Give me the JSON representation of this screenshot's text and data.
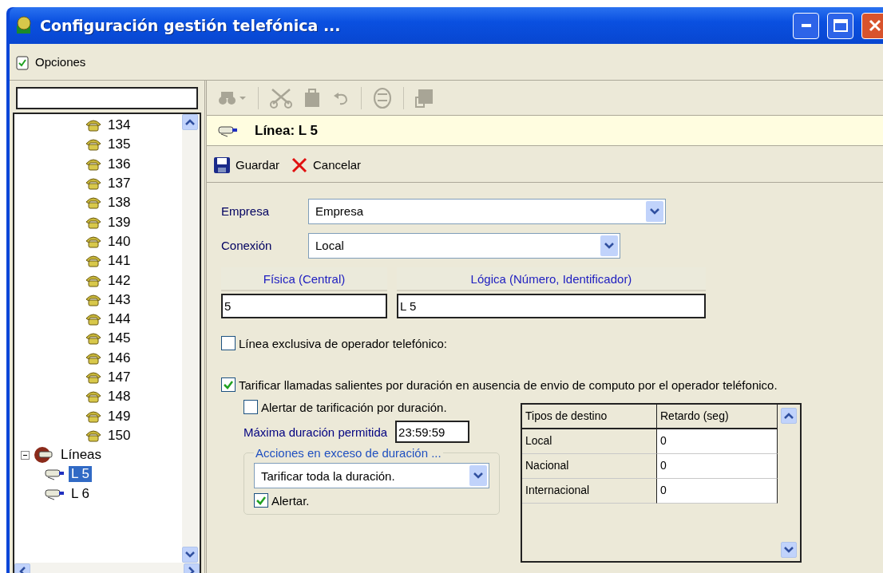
{
  "window": {
    "title": "Configuración gestión telefónica ..."
  },
  "menu": [
    {
      "label": "Opciones"
    }
  ],
  "tree": {
    "continued_branch": [
      {
        "label": "134",
        "selected": false
      },
      {
        "label": "135",
        "selected": false
      },
      {
        "label": "136",
        "selected": false
      },
      {
        "label": "137",
        "selected": false
      },
      {
        "label": "138",
        "selected": false
      },
      {
        "label": "139",
        "selected": false
      },
      {
        "label": "140",
        "selected": false
      },
      {
        "label": "141",
        "selected": false
      },
      {
        "label": "142",
        "selected": false
      },
      {
        "label": "143",
        "selected": false
      },
      {
        "label": "144",
        "selected": false
      },
      {
        "label": "145",
        "selected": false
      },
      {
        "label": "146",
        "selected": false
      },
      {
        "label": "147",
        "selected": false
      },
      {
        "label": "148",
        "selected": false
      },
      {
        "label": "149",
        "selected": false
      },
      {
        "label": "150",
        "selected": false
      }
    ],
    "items": [
      {
        "label": "Líneas",
        "expanded": true,
        "selected": false,
        "children": [
          {
            "label": "L 5",
            "selected": true
          },
          {
            "label": "L 6",
            "selected": false
          }
        ]
      }
    ]
  },
  "toolbar": [
    {
      "kind": "find",
      "disabled": true
    },
    {
      "kind": "cut",
      "disabled": true
    },
    {
      "kind": "paste",
      "disabled": true
    },
    {
      "kind": "undo",
      "disabled": true
    },
    {
      "kind": "face",
      "disabled": true
    },
    {
      "kind": "export",
      "disabled": true
    }
  ],
  "header": {
    "title": "Línea: L 5"
  },
  "actions": [
    {
      "kind": "save",
      "label": "Guardar"
    },
    {
      "kind": "cancel",
      "label": "Cancelar"
    }
  ],
  "form": {
    "empresa": {
      "label": "Empresa",
      "value": "Empresa"
    },
    "conexion": {
      "label": "Conexión",
      "value": "Local"
    },
    "fisica": {
      "header": "Física (Central)",
      "value": "5"
    },
    "logica": {
      "header": "Lógica (Número, Identificador)",
      "value": "L 5"
    },
    "exclusiva": {
      "label": "Línea exclusiva de operador telefónico:",
      "checked": false
    },
    "tarificar": {
      "label": "Tarificar llamadas salientes por duración en ausencia de envio de computo por el operador teléfonico.",
      "checked": true
    },
    "alertar_tarificacion": {
      "label": "Alertar de tarificación por duración.",
      "checked": false
    },
    "maxima": {
      "label": "Máxima duración permitida",
      "value": "23:59:59"
    },
    "acciones": {
      "legend": "Acciones en exceso de duración ...",
      "value": "Tarificar toda la duración.",
      "alertar": {
        "label": "Alertar.",
        "checked": true
      }
    },
    "table": {
      "columns": [
        "Tipos de destino",
        "Retardo (seg)"
      ],
      "rows": [
        [
          "Local",
          "0"
        ],
        [
          "Nacional",
          "0"
        ],
        [
          "Internacional",
          "0"
        ]
      ]
    }
  }
}
